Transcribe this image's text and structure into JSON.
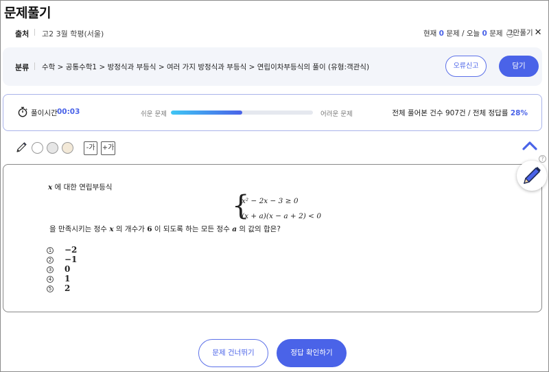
{
  "page": {
    "title": "문제풀기"
  },
  "source": {
    "label": "출처",
    "value": "고2 3월 학평(서울)"
  },
  "counter": {
    "prefix": "현재",
    "current": "0",
    "mid": "문제 / 오늘",
    "today": "0",
    "suffix": "문제",
    "help": "?"
  },
  "stop": {
    "label": "그만풀기",
    "icon": "close-icon",
    "glyph": "✕"
  },
  "category": {
    "label": "분류",
    "path": "수학 > 공통수학1 > 방정식과 부등식 > 여러 가지 방정식과 부등식 > 연립이차부등식의 풀이 (유형:객관식)",
    "report_label": "오류신고",
    "save_label": "담기"
  },
  "stats": {
    "timer_label": "풀이시간",
    "timer_value": "00:03",
    "easy_label": "쉬운 문제",
    "hard_label": "어려운 문제",
    "difficulty_level": 0.5,
    "summary_prefix": "전체 풀어본 건수 907건 / 전체 정답률",
    "accuracy": "28%"
  },
  "tools": {
    "pen_icon": "pencil-icon",
    "colors": [
      "#ffffff",
      "#e6e6e6",
      "#f3e9d8"
    ],
    "font_decrease": "-가",
    "font_increase": "+가",
    "collapse_icon": "chevron-up-icon",
    "help": "?"
  },
  "question": {
    "var": "x",
    "intro": "에 대한 연립부등식",
    "eq1": "x² − 2x − 3 ≥ 0",
    "eq2": "(x + a)(x − a + 2) < 0",
    "cond_1": "을 만족시키는 정수",
    "cond_2": "의 개수가",
    "count": "6",
    "cond_3": "이 되도록 하는 모든 정수",
    "param": "a",
    "cond_4": "의 값의 합은?",
    "choices": [
      {
        "num": "1",
        "value": "−2"
      },
      {
        "num": "2",
        "value": "−1"
      },
      {
        "num": "3",
        "value": "0"
      },
      {
        "num": "4",
        "value": "1"
      },
      {
        "num": "5",
        "value": "2"
      }
    ]
  },
  "actions": {
    "skip_label": "문제 건너뛰기",
    "check_label": "정답 확인하기"
  },
  "colors": {
    "accent": "#4a63e8",
    "panel": "#f3f5fa"
  }
}
